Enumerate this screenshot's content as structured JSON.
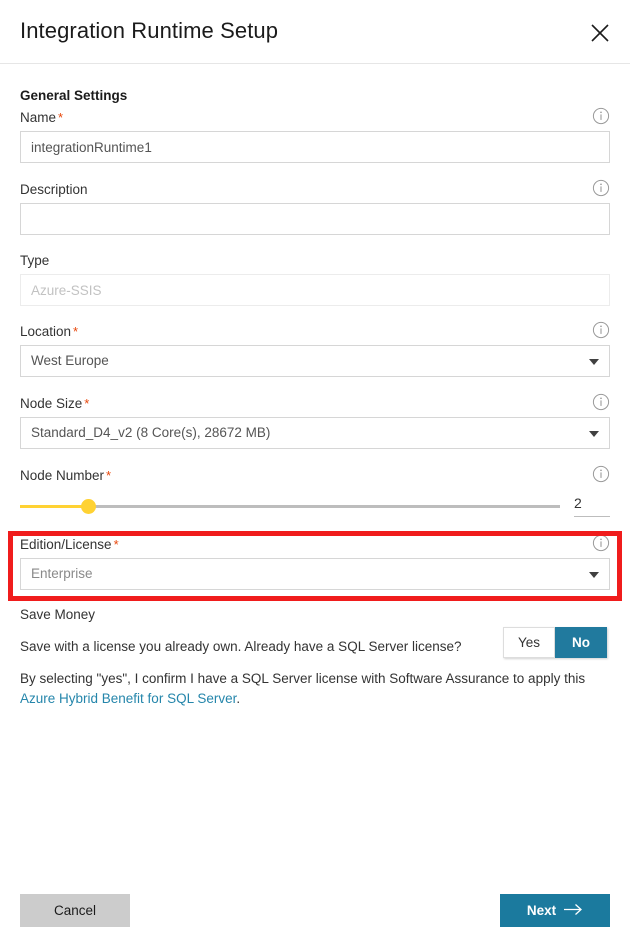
{
  "dialog": {
    "title": "Integration Runtime Setup",
    "close_icon": "close-icon"
  },
  "general_settings": {
    "heading": "General Settings"
  },
  "fields": {
    "name": {
      "label": "Name",
      "required_marker": "*",
      "value": "integrationRuntime1",
      "info_icon": "info-icon"
    },
    "description": {
      "label": "Description",
      "value": "",
      "placeholder": "",
      "info_icon": "info-icon"
    },
    "type": {
      "label": "Type",
      "value": "Azure-SSIS",
      "disabled": true
    },
    "location": {
      "label": "Location",
      "required_marker": "*",
      "value": "West Europe",
      "info_icon": "info-icon",
      "caret_icon": "chevron-down-icon"
    },
    "node_size": {
      "label": "Node Size",
      "required_marker": "*",
      "value": "Standard_D4_v2 (8 Core(s), 28672 MB)",
      "info_icon": "info-icon",
      "caret_icon": "chevron-down-icon"
    },
    "node_number": {
      "label": "Node Number",
      "required_marker": "*",
      "value": "2",
      "info_icon": "info-icon",
      "slider_min": "1",
      "slider_max": "10",
      "fill_color": "#ffd233",
      "track_color": "#bdbdbd"
    },
    "edition_license": {
      "label": "Edition/License",
      "required_marker": "*",
      "value": "Enterprise",
      "info_icon": "info-icon",
      "caret_icon": "chevron-down-icon",
      "highlight_color": "#f01c1c"
    }
  },
  "save_money": {
    "heading": "Save Money",
    "question": "Save with a license you already own. Already have a SQL Server license?",
    "yes_label": "Yes",
    "no_label": "No",
    "selected": "No",
    "consent_prefix": "By selecting \"yes\", I confirm I have a SQL Server license with Software Assurance to apply this ",
    "consent_link": "Azure Hybrid Benefit for SQL Server",
    "consent_suffix": ".",
    "selected_color": "#217a9e",
    "link_color": "#2586ab"
  },
  "footer": {
    "cancel_label": "Cancel",
    "next_label": "Next",
    "next_icon": "arrow-right-icon",
    "next_color": "#1b7a9e",
    "cancel_color": "#cccccc"
  }
}
